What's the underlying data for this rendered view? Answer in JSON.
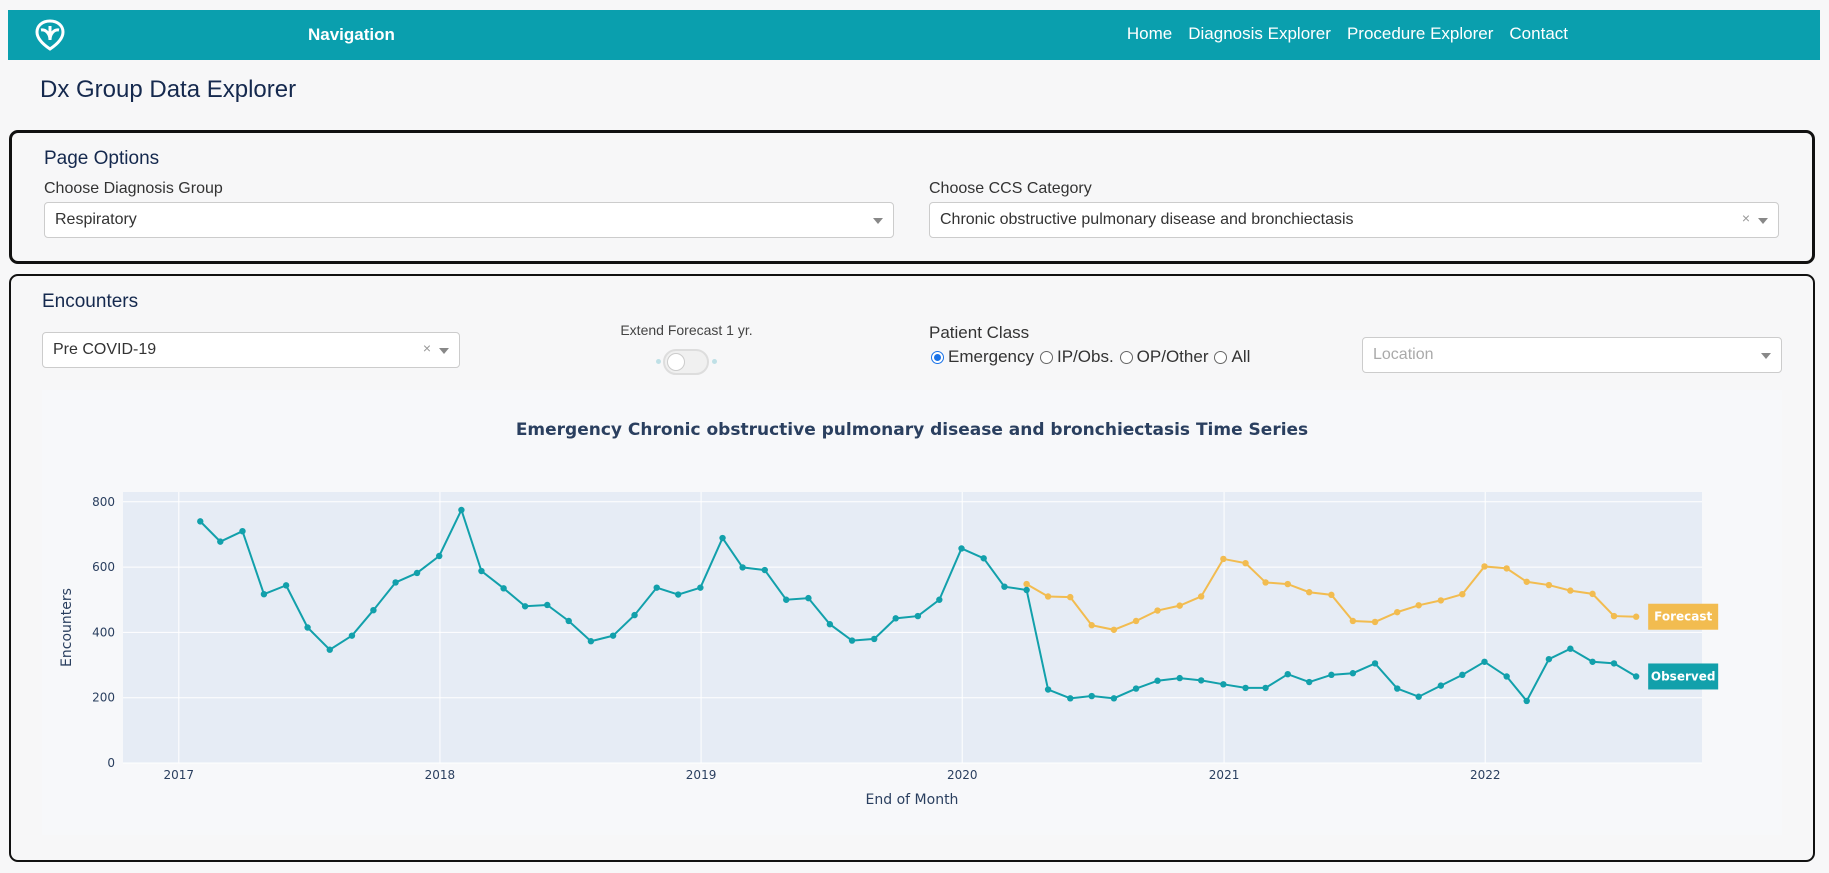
{
  "nav": {
    "brand": "Navigation",
    "links": [
      "Home",
      "Diagnosis Explorer",
      "Procedure Explorer",
      "Contact"
    ]
  },
  "page_title": "Dx Group Data Explorer",
  "options": {
    "title": "Page Options",
    "dx_group_label": "Choose Diagnosis Group",
    "dx_group_value": "Respiratory",
    "ccs_label": "Choose CCS Category",
    "ccs_value": "Chronic obstructive pulmonary disease and bronchiectasis"
  },
  "encounters": {
    "title": "Encounters",
    "period_value": "Pre COVID-19",
    "toggle_label": "Extend Forecast 1 yr.",
    "toggle_on": false,
    "patient_class_label": "Patient Class",
    "patient_class_options": [
      "Emergency",
      "IP/Obs.",
      "OP/Other",
      "All"
    ],
    "patient_class_selected": "Emergency",
    "location_placeholder": "Location"
  },
  "colors": {
    "brand": "#0a9fae",
    "observed": "#12a0ab",
    "forecast": "#f2bc50",
    "plot_bg": "#e6ecf5"
  },
  "chart_data": {
    "type": "line",
    "title": "Emergency Chronic obstructive pulmonary disease and bronchiectasis Time Series",
    "xlabel": "End of Month",
    "ylabel": "Encounters",
    "ylim": [
      0,
      830
    ],
    "xlim": [
      "2016-10-15",
      "2022-10-31"
    ],
    "y_ticks": [
      0,
      200,
      400,
      600,
      800
    ],
    "x_ticks": [
      "2017",
      "2018",
      "2019",
      "2020",
      "2021",
      "2022"
    ],
    "legend_placement": "right, at series end",
    "series": [
      {
        "name": "Observed",
        "start": "2017-01",
        "values": [
          740,
          678,
          710,
          517,
          544,
          415,
          347,
          390,
          468,
          553,
          582,
          634,
          775,
          588,
          535,
          480,
          484,
          435,
          373,
          390,
          453,
          537,
          516,
          537,
          689,
          599,
          591,
          500,
          505,
          425,
          375,
          380,
          443,
          450,
          500,
          657,
          627,
          540,
          530,
          225,
          198,
          205,
          198,
          228,
          252,
          260,
          253,
          241,
          230,
          230,
          272,
          248,
          270,
          275,
          305,
          228,
          203,
          237,
          270,
          310,
          265,
          190,
          318,
          350,
          310,
          305,
          265
        ]
      },
      {
        "name": "Forecast",
        "start": "2020-03",
        "values": [
          548,
          510,
          508,
          422,
          408,
          435,
          467,
          482,
          510,
          625,
          612,
          553,
          548,
          523,
          515,
          435,
          432,
          462,
          483,
          498,
          517,
          602,
          596,
          555,
          545,
          528,
          518,
          450,
          448
        ]
      }
    ]
  }
}
